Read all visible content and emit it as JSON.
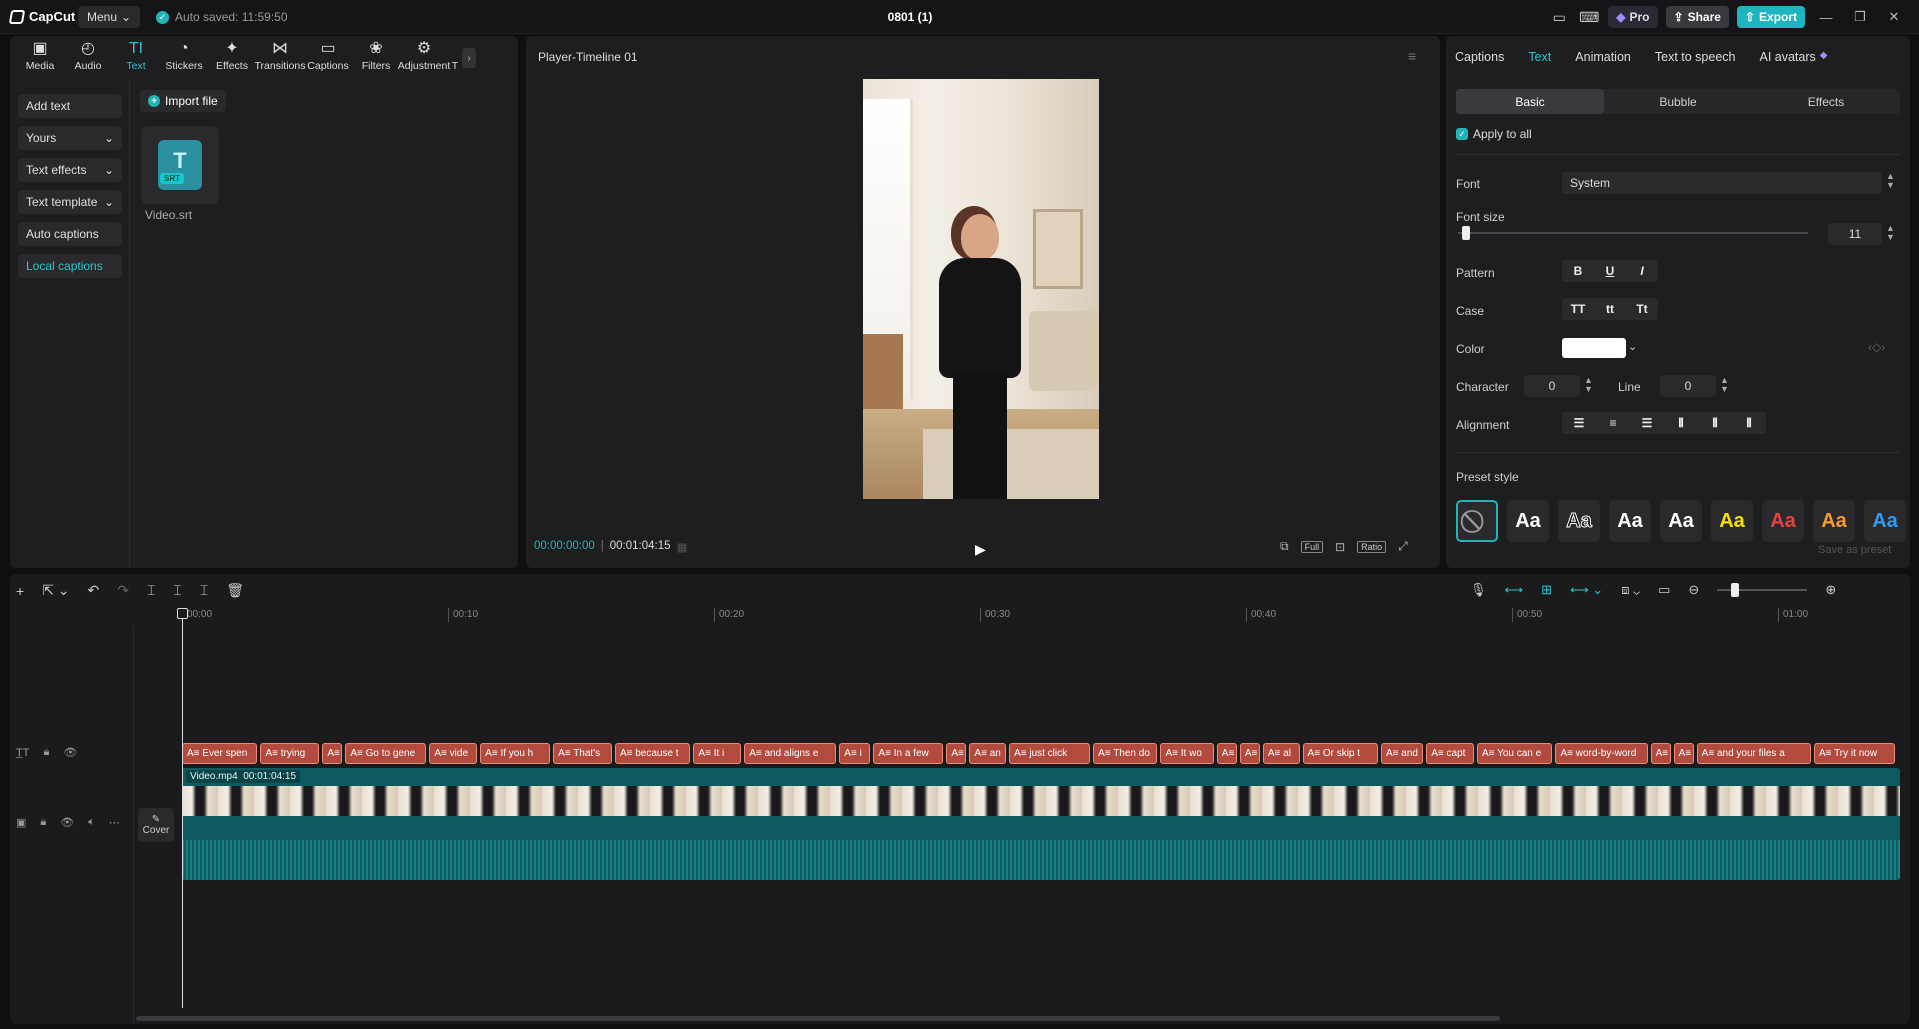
{
  "app": {
    "logo_text": "CapCut",
    "menu_label": "Menu",
    "autosave": "Auto saved: 11:59:50",
    "doc_title": "0801 (1)"
  },
  "topbar": {
    "pro_label": "Pro",
    "share_label": "Share",
    "export_label": "Export"
  },
  "toolbar": [
    {
      "label": "Media",
      "icon": "media-icon"
    },
    {
      "label": "Audio",
      "icon": "audio-icon"
    },
    {
      "label": "Text",
      "icon": "text-icon",
      "active": true
    },
    {
      "label": "Stickers",
      "icon": "stickers-icon"
    },
    {
      "label": "Effects",
      "icon": "effects-icon"
    },
    {
      "label": "Transitions",
      "icon": "transitions-icon"
    },
    {
      "label": "Captions",
      "icon": "captions-icon"
    },
    {
      "label": "Filters",
      "icon": "filters-icon"
    },
    {
      "label": "Adjustment",
      "icon": "adjustment-icon"
    },
    {
      "label": "T",
      "icon": "more-icon"
    }
  ],
  "sidenav": [
    {
      "label": "Add text"
    },
    {
      "label": "Yours",
      "chevron": true
    },
    {
      "label": "Text effects",
      "chevron": true
    },
    {
      "label": "Text template",
      "chevron": true
    },
    {
      "label": "Auto captions"
    },
    {
      "label": "Local captions",
      "active": true
    }
  ],
  "library": {
    "import_label": "Import file",
    "file_name": "Video.srt",
    "file_badge": "SRT",
    "file_glyph": "T"
  },
  "player": {
    "title": "Player-Timeline 01",
    "current_time": "00:00:00:00",
    "duration": "00:01:04:15",
    "full_label": "Full",
    "ratio_label": "Ratio"
  },
  "right": {
    "tabs": [
      {
        "label": "Captions"
      },
      {
        "label": "Text",
        "active": true
      },
      {
        "label": "Animation"
      },
      {
        "label": "Text to speech"
      },
      {
        "label": "AI avatars"
      }
    ],
    "subtabs": [
      {
        "label": "Basic",
        "active": true
      },
      {
        "label": "Bubble"
      },
      {
        "label": "Effects"
      }
    ],
    "apply_all": "Apply to all",
    "font_label": "Font",
    "font_value": "System",
    "font_size_label": "Font size",
    "font_size_value": "11",
    "pattern_label": "Pattern",
    "pattern_buttons": [
      "B",
      "U",
      "I"
    ],
    "case_label": "Case",
    "case_buttons": [
      "TT",
      "tt",
      "Tt"
    ],
    "color_label": "Color",
    "color_value": "#ffffff",
    "character_label": "Character",
    "character_value": "0",
    "line_label": "Line",
    "line_value": "0",
    "alignment_label": "Alignment",
    "preset_label": "Preset style",
    "presets": [
      {
        "glyph": "⃠",
        "color": "#999999"
      },
      {
        "glyph": "Aa",
        "color": "#ffffff"
      },
      {
        "glyph": "Aa",
        "color": "#ffffff",
        "outline": true
      },
      {
        "glyph": "Aa",
        "color": "#ffffff"
      },
      {
        "glyph": "Aa",
        "color": "#ffffff"
      },
      {
        "glyph": "Aa",
        "color": "#f5e000"
      },
      {
        "glyph": "Aa",
        "color": "#e64040"
      },
      {
        "glyph": "Aa",
        "color": "#f39a2c"
      },
      {
        "glyph": "Aa",
        "color": "#2f9cf0"
      }
    ],
    "save_preset": "Save as preset"
  },
  "timeline": {
    "ruler": [
      "00:00",
      "00:10",
      "00:20",
      "00:30",
      "00:40",
      "00:50",
      "01:00"
    ],
    "captions": [
      "A≡ Ever spen",
      "A≡ trying",
      "A≡",
      "A≡ Go to gene",
      "A≡ vide",
      "A≡ If you h",
      "A≡ That's",
      "A≡ because t",
      "A≡ It i",
      "A≡ and aligns e",
      "A≡ i",
      "A≡ In a few",
      "A≡",
      "A≡ an",
      "A≡ just click",
      "A≡ Then do",
      "A≡ It wo",
      "A≡",
      "A≡",
      "A≡ al",
      "A≡ Or skip t",
      "A≡ and",
      "A≡ capt",
      "A≡ You can e",
      "A≡ word-by-word",
      "A≡",
      "A≡",
      "A≡ and your files a",
      "A≡ Try it now"
    ],
    "video_name": "Video.mp4",
    "video_duration": "00:01:04:15",
    "cover_label": "Cover"
  }
}
